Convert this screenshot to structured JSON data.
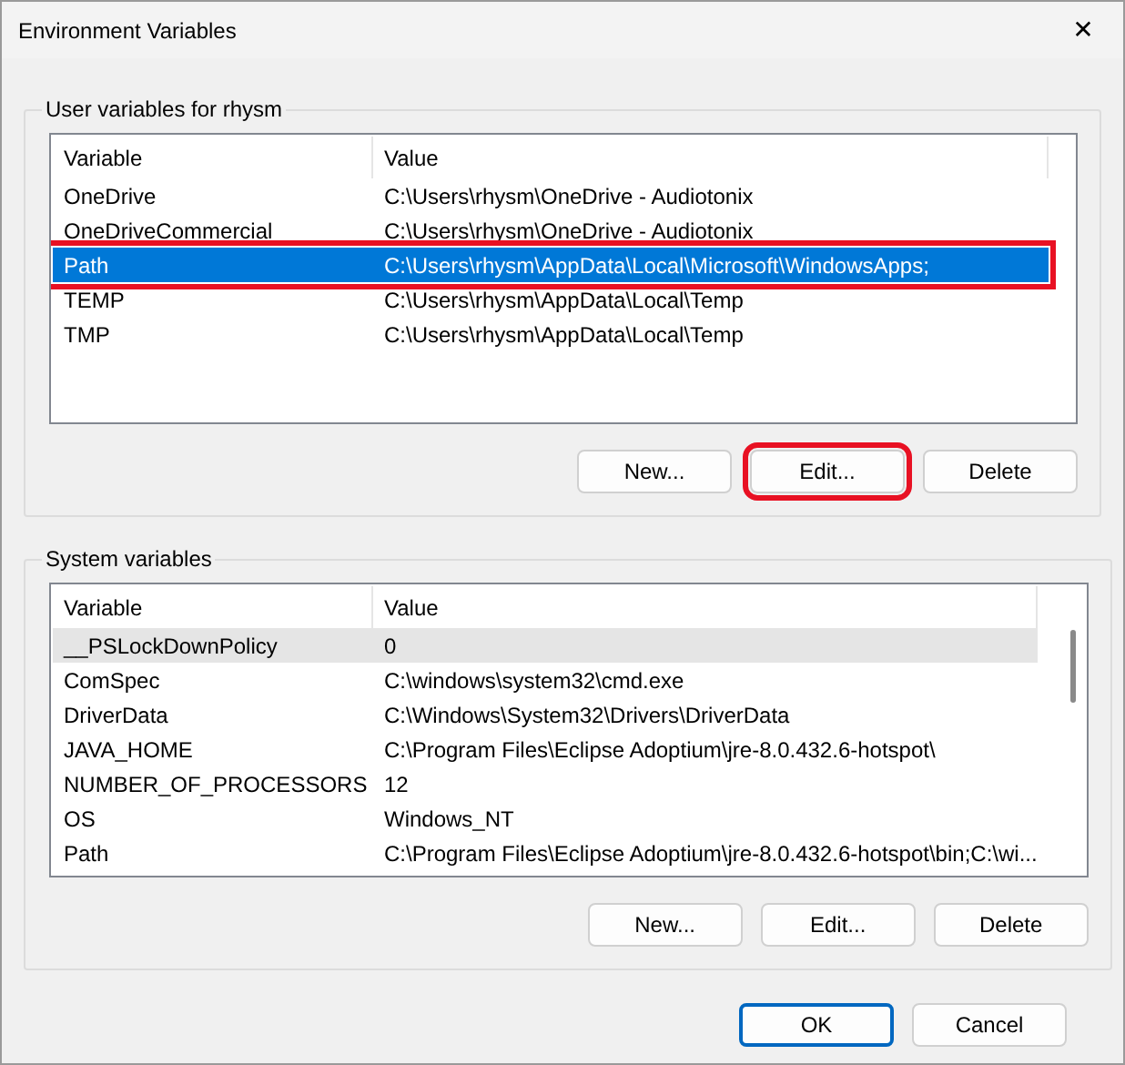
{
  "window": {
    "title": "Environment Variables",
    "close": "✕"
  },
  "groups": [
    {
      "title": "User variables for rhysm",
      "columns": [
        "Variable",
        "Value"
      ],
      "scrollbar": false,
      "rows": [
        {
          "variable": "OneDrive",
          "value": "C:\\Users\\rhysm\\OneDrive - Audiotonix",
          "selected": false,
          "annotated": false
        },
        {
          "variable": "OneDriveCommercial",
          "value": "C:\\Users\\rhysm\\OneDrive - Audiotonix",
          "selected": false,
          "annotated": false
        },
        {
          "variable": "Path",
          "value": "C:\\Users\\rhysm\\AppData\\Local\\Microsoft\\WindowsApps;",
          "selected": true,
          "annotated": true
        },
        {
          "variable": "TEMP",
          "value": "C:\\Users\\rhysm\\AppData\\Local\\Temp",
          "selected": false,
          "annotated": false
        },
        {
          "variable": "TMP",
          "value": "C:\\Users\\rhysm\\AppData\\Local\\Temp",
          "selected": false,
          "annotated": false
        }
      ],
      "buttons": [
        {
          "label": "New...",
          "annotated": false
        },
        {
          "label": "Edit...",
          "annotated": true
        },
        {
          "label": "Delete",
          "annotated": false
        }
      ]
    },
    {
      "title": "System variables",
      "columns": [
        "Variable",
        "Value"
      ],
      "scrollbar": true,
      "rows": [
        {
          "variable": "__PSLockDownPolicy",
          "value": "0",
          "selected": true,
          "annotated": false
        },
        {
          "variable": "ComSpec",
          "value": "C:\\windows\\system32\\cmd.exe",
          "selected": false,
          "annotated": false
        },
        {
          "variable": "DriverData",
          "value": "C:\\Windows\\System32\\Drivers\\DriverData",
          "selected": false,
          "annotated": false
        },
        {
          "variable": "JAVA_HOME",
          "value": "C:\\Program Files\\Eclipse Adoptium\\jre-8.0.432.6-hotspot\\",
          "selected": false,
          "annotated": false
        },
        {
          "variable": "NUMBER_OF_PROCESSORS",
          "value": "12",
          "selected": false,
          "annotated": false
        },
        {
          "variable": "OS",
          "value": "Windows_NT",
          "selected": false,
          "annotated": false
        },
        {
          "variable": "Path",
          "value": "C:\\Program Files\\Eclipse Adoptium\\jre-8.0.432.6-hotspot\\bin;C:\\wi...",
          "selected": false,
          "annotated": false
        }
      ],
      "buttons": [
        {
          "label": "New...",
          "annotated": false
        },
        {
          "label": "Edit...",
          "annotated": false
        },
        {
          "label": "Delete",
          "annotated": false
        }
      ]
    }
  ],
  "footer": [
    {
      "label": "OK",
      "default": true
    },
    {
      "label": "Cancel",
      "default": false
    }
  ]
}
